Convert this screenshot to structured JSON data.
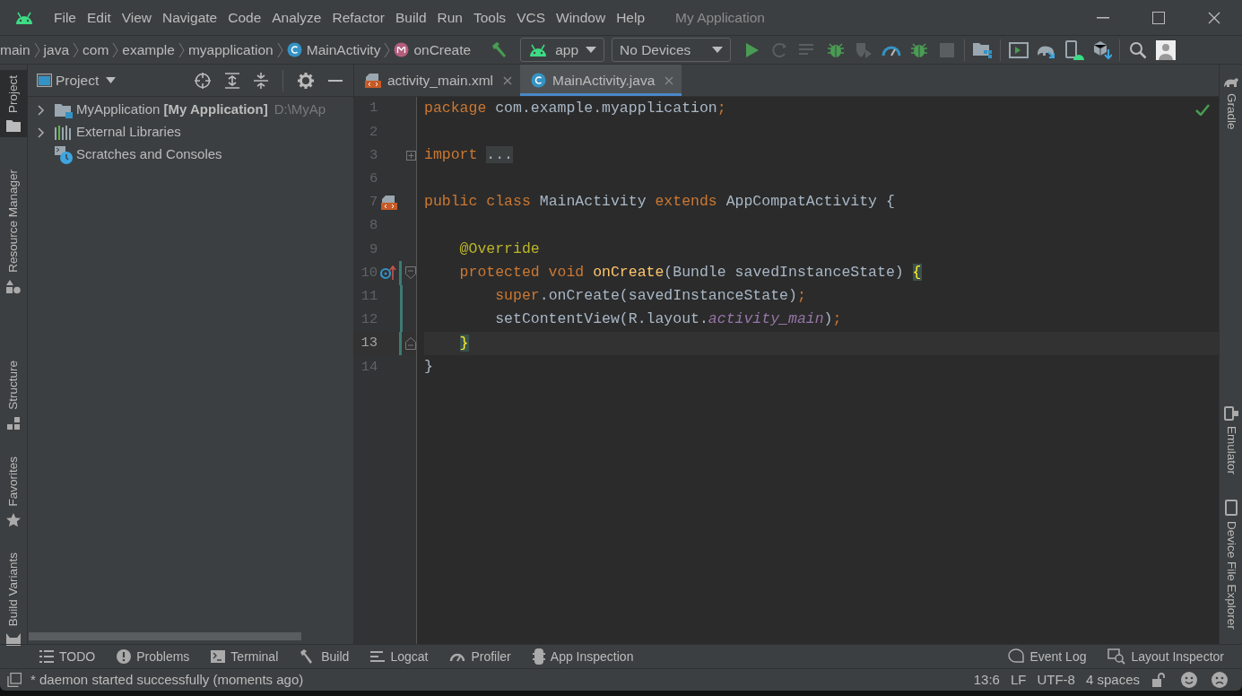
{
  "window": {
    "title": "My Application"
  },
  "menu": [
    "File",
    "Edit",
    "View",
    "Navigate",
    "Code",
    "Analyze",
    "Refactor",
    "Build",
    "Run",
    "Tools",
    "VCS",
    "Window",
    "Help"
  ],
  "breadcrumbs": [
    {
      "label": "main",
      "kind": "folder"
    },
    {
      "label": "java",
      "kind": "folder"
    },
    {
      "label": "com",
      "kind": "folder"
    },
    {
      "label": "example",
      "kind": "folder"
    },
    {
      "label": "myapplication",
      "kind": "folder"
    },
    {
      "label": "MainActivity",
      "kind": "class"
    },
    {
      "label": "onCreate",
      "kind": "method"
    }
  ],
  "run_config": {
    "label": "app"
  },
  "device": {
    "label": "No Devices"
  },
  "left_stripe": [
    {
      "label": "Project",
      "kind": "project",
      "selected": true
    },
    {
      "label": "Resource Manager",
      "kind": "resources",
      "selected": false
    },
    {
      "label": "Structure",
      "kind": "structure",
      "selected": false
    },
    {
      "label": "Favorites",
      "kind": "favorites",
      "selected": false
    },
    {
      "label": "Build Variants",
      "kind": "variants",
      "selected": false
    }
  ],
  "right_stripe": [
    {
      "label": "Gradle",
      "kind": "gradle"
    },
    {
      "label": "Emulator",
      "kind": "emulator"
    },
    {
      "label": "Device File Explorer",
      "kind": "device"
    }
  ],
  "project_panel": {
    "title": "Project",
    "tree": [
      {
        "label": "MyApplication **[My Application]**",
        "path": "D:\\MyAp",
        "kind": "module",
        "has_children": true,
        "expanded": false
      },
      {
        "label": "External Libraries",
        "kind": "libraries",
        "has_children": true,
        "expanded": false
      },
      {
        "label": "Scratches and Consoles",
        "kind": "scratches",
        "has_children": false
      }
    ]
  },
  "tabs": [
    {
      "label": "activity_main.xml",
      "kind": "layout",
      "selected": false
    },
    {
      "label": "MainActivity.java",
      "kind": "class",
      "selected": true
    }
  ],
  "code": [
    {
      "number": "1",
      "tokens": [
        {
          "kind": "kw",
          "text": "package"
        },
        {
          "kind": "plain",
          "text": " com.example.myapplication"
        },
        {
          "kind": "kw",
          "text": ";"
        }
      ]
    },
    {
      "number": "2"
    },
    {
      "number": "3",
      "fold_start": true,
      "folded": true,
      "tokens": [
        {
          "kind": "kw",
          "text": "import "
        },
        {
          "kind": "folded",
          "text": "..."
        }
      ]
    },
    {
      "number": "6"
    },
    {
      "number": "7",
      "layout_link": true,
      "tokens": [
        {
          "kind": "kw",
          "text": "public class"
        },
        {
          "kind": "plain",
          "text": " MainActivity "
        },
        {
          "kind": "kw",
          "text": "extends"
        },
        {
          "kind": "plain",
          "text": " AppCompatActivity {"
        }
      ]
    },
    {
      "number": "8"
    },
    {
      "number": "9",
      "tokens": [
        {
          "kind": "ann",
          "text": "    @Override"
        }
      ]
    },
    {
      "number": "10",
      "changed": true,
      "overrides": true,
      "fold_start": true,
      "folded": false,
      "tokens": [
        {
          "kind": "kw",
          "text": "    protected void "
        },
        {
          "kind": "fn",
          "text": "onCreate"
        },
        {
          "kind": "plain",
          "text": "(Bundle savedInstanceState) "
        },
        {
          "kind": "brace",
          "text": "{"
        }
      ]
    },
    {
      "number": "11",
      "changed": true,
      "tokens": [
        {
          "kind": "kw",
          "text": "        super"
        },
        {
          "kind": "plain",
          "text": ".onCreate(savedInstanceState)"
        },
        {
          "kind": "kw",
          "text": ";"
        }
      ]
    },
    {
      "number": "12",
      "changed": true,
      "tokens": [
        {
          "kind": "plain",
          "text": "        setContentView(R.layout."
        },
        {
          "kind": "field",
          "text": "activity_main"
        },
        {
          "kind": "plain",
          "text": ")"
        },
        {
          "kind": "kw",
          "text": ";"
        }
      ]
    },
    {
      "number": "13",
      "current": true,
      "changed": true,
      "fold_end": true,
      "tokens": [
        {
          "kind": "brace",
          "text": "    }"
        }
      ]
    },
    {
      "number": "14",
      "tokens": [
        {
          "kind": "plain",
          "text": "}"
        }
      ]
    }
  ],
  "tool_windows": [
    {
      "label": "TODO",
      "kind": "todo"
    },
    {
      "label": "Problems",
      "kind": "problems"
    },
    {
      "label": "Terminal",
      "kind": "terminal"
    },
    {
      "label": "Build",
      "kind": "build"
    },
    {
      "label": "Logcat",
      "kind": "logcat"
    },
    {
      "label": "Profiler",
      "kind": "profiler"
    },
    {
      "label": "App Inspection",
      "kind": "inspection"
    }
  ],
  "tool_windows_right": [
    {
      "label": "Event Log",
      "kind": "eventlog"
    },
    {
      "label": "Layout Inspector",
      "kind": "layoutinspector"
    }
  ],
  "status_bar": {
    "message": "* daemon started successfully (moments ago)",
    "position": "13:6",
    "line_separator": "LF",
    "encoding": "UTF-8",
    "indent": "4 spaces"
  }
}
